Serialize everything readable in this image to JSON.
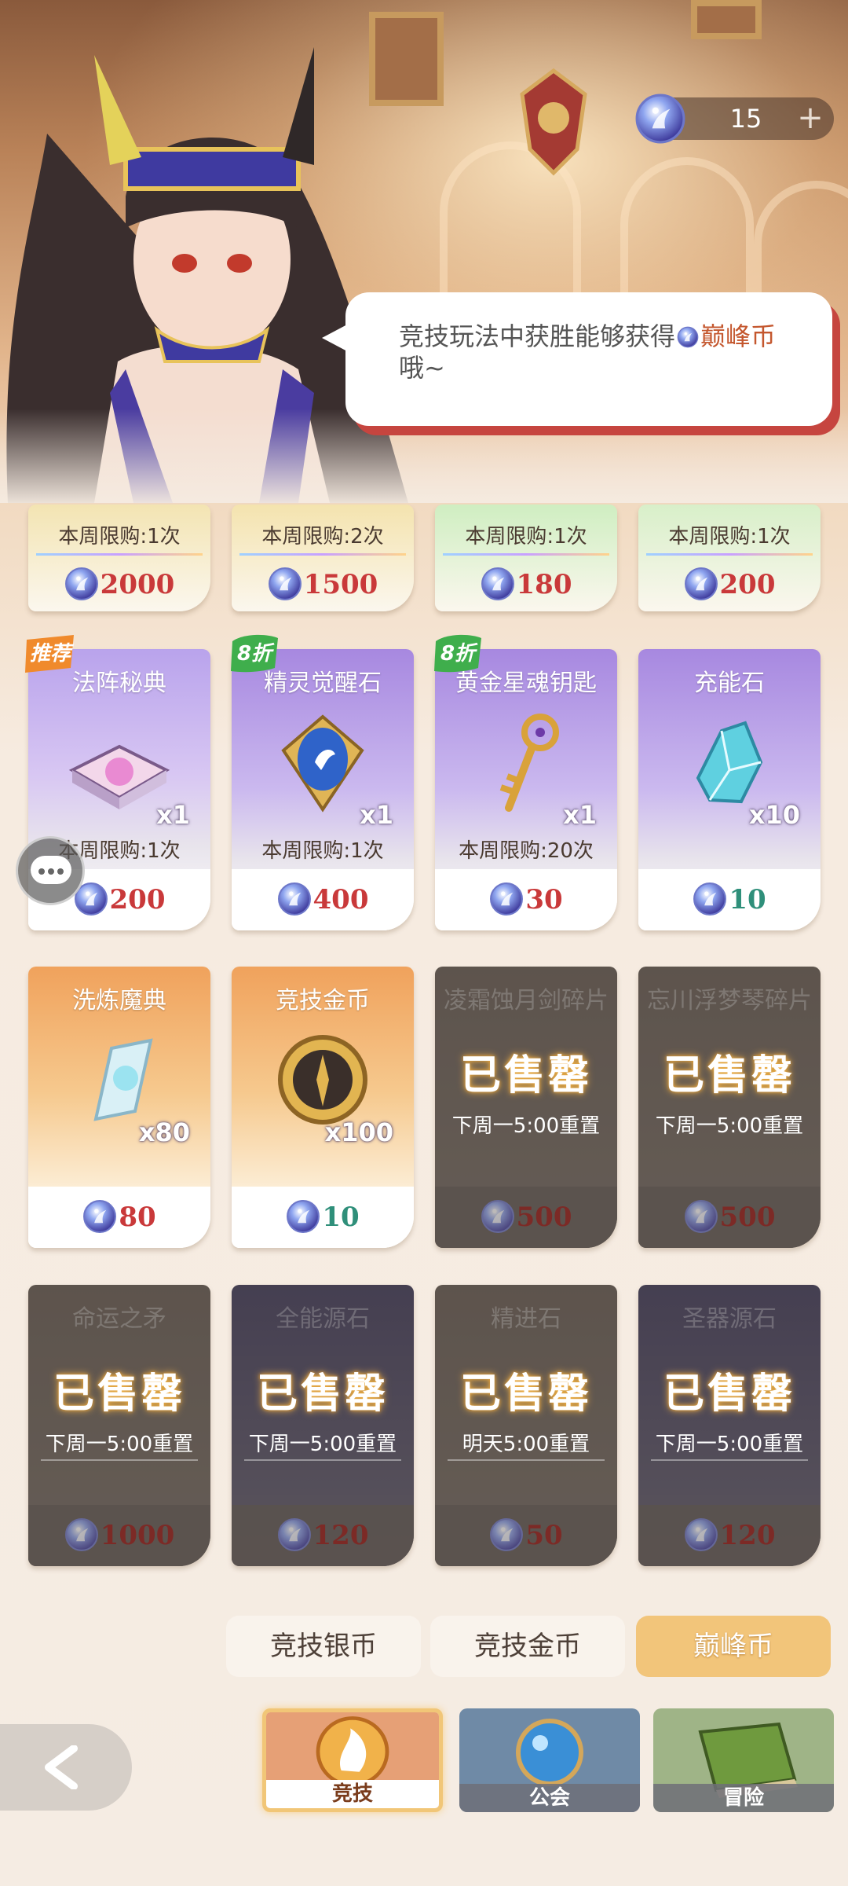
{
  "currency": {
    "amount": "15",
    "plus_label": "+"
  },
  "bubble": {
    "text_before": "竞技玩法中获胜能够获得",
    "highlight": "巅峰币",
    "text_after": "哦~"
  },
  "top_row": [
    {
      "limit": "本周限购:1次",
      "price": "2000"
    },
    {
      "limit": "本周限购:2次",
      "price": "1500"
    },
    {
      "limit": "本周限购:1次",
      "price": "180"
    },
    {
      "limit": "本周限购:1次",
      "price": "200"
    }
  ],
  "row1": [
    {
      "title": "法阵秘典",
      "qty": "x1",
      "limit": "本周限购:1次",
      "price": "200",
      "badge": "推荐"
    },
    {
      "title": "精灵觉醒石",
      "qty": "x1",
      "limit": "本周限购:1次",
      "price": "400",
      "badge": "8折"
    },
    {
      "title": "黄金星魂钥匙",
      "qty": "x1",
      "limit": "本周限购:20次",
      "price": "30",
      "badge": "8折"
    },
    {
      "title": "充能石",
      "qty": "x10",
      "price": "10"
    }
  ],
  "row2": [
    {
      "title": "洗炼魔典",
      "qty": "x80",
      "price": "80"
    },
    {
      "title": "竞技金币",
      "qty": "x100",
      "price": "10"
    },
    {
      "title": "凌霜蚀月剑碎片",
      "sold": "已售罄",
      "reset": "下周一5:00重置",
      "price": "500"
    },
    {
      "title": "忘川浮梦琴碎片",
      "sold": "已售罄",
      "reset": "下周一5:00重置",
      "price": "500"
    }
  ],
  "row3": [
    {
      "title": "命运之矛",
      "sold": "已售罄",
      "reset": "下周一5:00重置",
      "price": "1000"
    },
    {
      "title": "全能源石",
      "sold": "已售罄",
      "reset": "下周一5:00重置",
      "price": "120"
    },
    {
      "title": "精进石",
      "sold": "已售罄",
      "reset": "明天5:00重置",
      "price": "50"
    },
    {
      "title": "圣器源石",
      "sold": "已售罄",
      "reset": "下周一5:00重置",
      "price": "120"
    }
  ],
  "currency_tabs": [
    "竞技银币",
    "竞技金币",
    "巅峰币"
  ],
  "nav_tabs": [
    "竞技",
    "公会",
    "冒险"
  ],
  "colors": {
    "accent": "#f2c57a",
    "price_red": "#c9393a",
    "price_green": "#2f8f7a",
    "badge_orange": "#f08a2c",
    "badge_green": "#3fae4c"
  }
}
